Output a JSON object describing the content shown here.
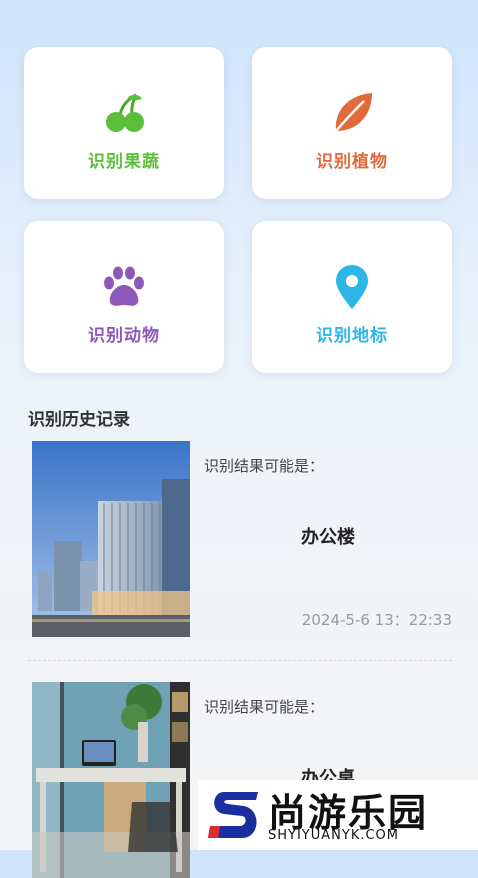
{
  "cards": [
    {
      "label": "识别果蔬",
      "color": "#5cbf3a",
      "icon": "cherry-icon"
    },
    {
      "label": "识别植物",
      "color": "#e06a3a",
      "icon": "leaf-icon"
    },
    {
      "label": "识别动物",
      "color": "#8e58b8",
      "icon": "paw-icon"
    },
    {
      "label": "识别地标",
      "color": "#2cb6e6",
      "icon": "location-pin-icon"
    }
  ],
  "history": {
    "title": "识别历史记录",
    "records": [
      {
        "caption": "识别结果可能是：",
        "result": "办公楼",
        "time": "2024-5-6 13：22:33",
        "image": "office-building-photo"
      },
      {
        "caption": "识别结果可能是：",
        "result": "办公桌",
        "image": "office-desk-photo"
      }
    ]
  },
  "watermark": {
    "brand": "尚游乐园",
    "url": "SHYIYUANYK.COM"
  }
}
